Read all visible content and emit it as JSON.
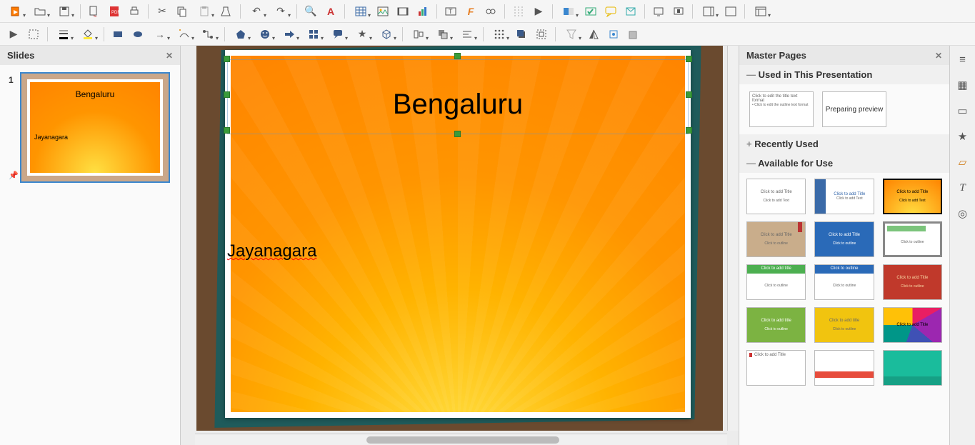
{
  "slide": {
    "title": "Bengaluru",
    "subtitle": "Jayanagara"
  },
  "slides_panel": {
    "header": "Slides",
    "items": [
      {
        "num": "1",
        "title": "Bengaluru",
        "subtitle": "Jayanagara"
      }
    ]
  },
  "master_panel": {
    "header": "Master Pages",
    "used_section": "Used in This Presentation",
    "recently_section": "Recently Used",
    "available_section": "Available for Use",
    "preparing": "Preparing preview",
    "used_thumb_lines": [
      "Click to edit the title text format",
      "• Click to edit the outline text format"
    ],
    "available_text": {
      "click_title": "Click to add Title",
      "click_text": "Click to add Text",
      "click_title_sm": "Click to add title",
      "click_outline": "Click to outline"
    }
  },
  "toolbar1_icons": [
    "new",
    "open",
    "save",
    "exp",
    "pdf",
    "print",
    "cut",
    "copy",
    "paste",
    "clone",
    "brush",
    "undo",
    "redo",
    "find",
    "spell",
    "table",
    "image",
    "av",
    "chart",
    "textbox",
    "font",
    "special",
    "line",
    "play",
    "master",
    "spellauto",
    "comment",
    "mp",
    "display",
    "proj",
    "handout",
    "layout",
    "template"
  ],
  "toolbar2_icons": [
    "pointer",
    "zoombox",
    "linecolor",
    "fillcolor",
    "rect",
    "ellipse",
    "arrow",
    "curve",
    "connector",
    "shape",
    "smiley",
    "blockarr",
    "callout",
    "flowshape",
    "star",
    "3d",
    "align",
    "arrange",
    "distribute",
    "shadow",
    "crop",
    "filter",
    "flip",
    "position",
    "extrude",
    "toggle"
  ]
}
